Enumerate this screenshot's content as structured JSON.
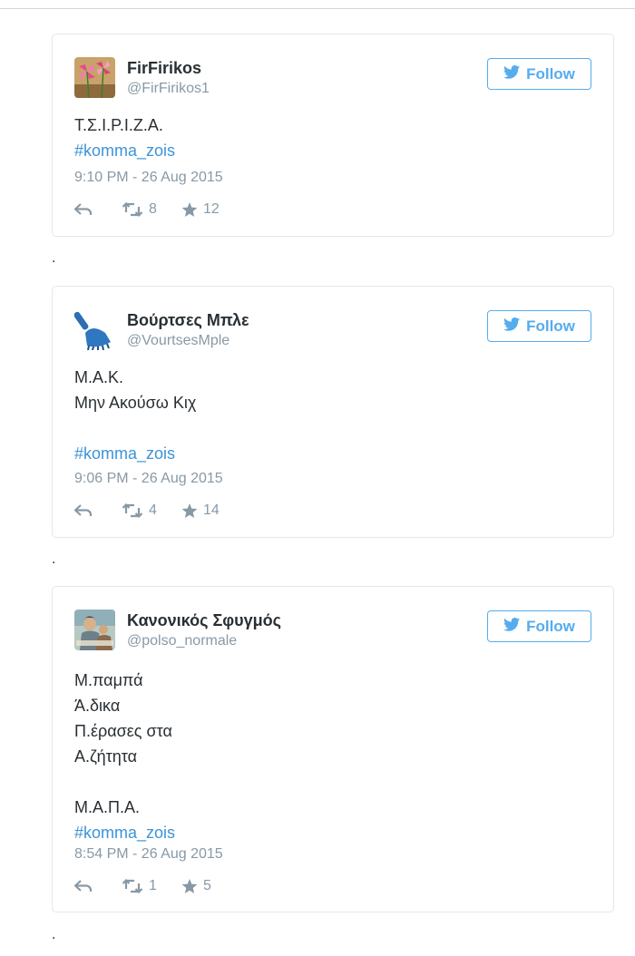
{
  "tweets": [
    {
      "name": "FirFirikos",
      "handle": "@FirFirikos1",
      "follow_label": "Follow",
      "lines": [
        "Τ.Σ.Ι.Ρ.Ι.Ζ.Α."
      ],
      "hashtag": "#komma_zois",
      "time": "9:10 PM - 26 Aug 2015",
      "retweets": "8",
      "favorites": "12",
      "avatar_icon": "pinwheel-avatar"
    },
    {
      "name": "Βούρτσες Μπλε",
      "handle": "@VourtsesMple",
      "follow_label": "Follow",
      "lines": [
        "Μ.Α.Κ.",
        "Μην Ακούσω Κιχ",
        ""
      ],
      "hashtag": "#komma_zois",
      "time": "9:06 PM - 26 Aug 2015",
      "retweets": "4",
      "favorites": "14",
      "avatar_icon": "blue-brush-avatar"
    },
    {
      "name": "Κανονικός Σφυγμός",
      "handle": "@polso_normale",
      "follow_label": "Follow",
      "lines": [
        "Μ.παμπά",
        "Ά.δικα",
        "Π.έρασες στα",
        "Α.ζήτητα",
        "",
        "Μ.Α.Π.Α."
      ],
      "hashtag": "#komma_zois",
      "time": "8:54 PM - 26 Aug 2015",
      "retweets": "1",
      "favorites": "5",
      "avatar_icon": "painting-avatar"
    }
  ],
  "separator": ".",
  "colors": {
    "twitter_blue": "#55acee",
    "hashtag": "#3b94d9",
    "muted": "#8899a6",
    "text": "#292f33",
    "card_border": "#e1e8ed"
  }
}
